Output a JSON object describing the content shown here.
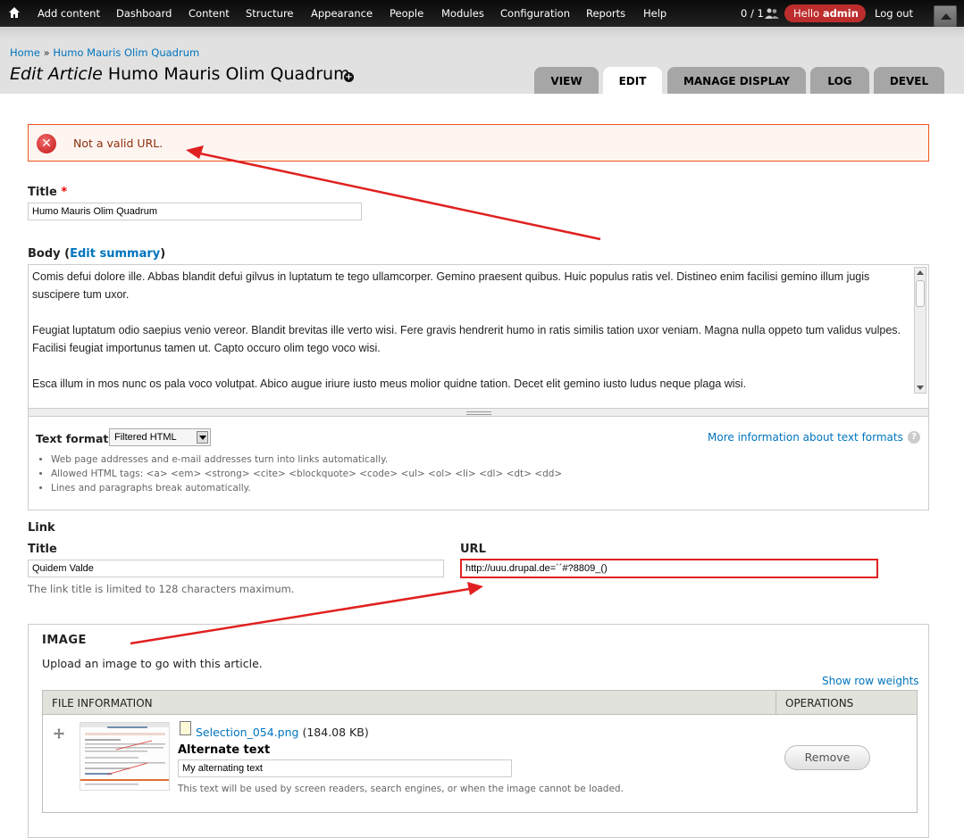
{
  "toolbar": {
    "menu": [
      "Add content",
      "Dashboard",
      "Content",
      "Structure",
      "Appearance",
      "People",
      "Modules",
      "Configuration",
      "Reports",
      "Help"
    ],
    "users_count": "0 / 1",
    "hello_prefix": "Hello",
    "hello_user": "admin",
    "logout": "Log out"
  },
  "breadcrumb": {
    "home": "Home",
    "separator": "»",
    "current": "Humo Mauris Olim Quadrum"
  },
  "page_title": {
    "prefix": "Edit Article",
    "title": "Humo Mauris Olim Quadrum"
  },
  "tabs": [
    "VIEW",
    "EDIT",
    "MANAGE DISPLAY",
    "LOG",
    "DEVEL"
  ],
  "active_tab": "EDIT",
  "message": {
    "type": "error",
    "text": "Not a valid URL."
  },
  "title_field": {
    "label": "Title",
    "required_marker": "*",
    "value": "Humo Mauris Olim Quadrum"
  },
  "body_field": {
    "label": "Body",
    "paren_open": "(",
    "summary_link": "Edit summary",
    "paren_close": ")",
    "paragraphs": [
      "Comis defui dolore ille. Abbas blandit defui gilvus in luptatum te tego ullamcorper. Gemino praesent quibus. Huic populus ratis vel. Distineo enim facilisi gemino illum jugis suscipere tum uxor.",
      "Feugiat luptatum odio saepius venio vereor. Blandit brevitas ille verto wisi. Fere gravis hendrerit humo in ratis similis tation uxor veniam. Magna nulla oppeto tum validus vulpes. Facilisi feugiat importunus tamen ut. Capto occuro olim tego voco wisi.",
      "Esca illum in mos nunc os pala voco volutpat. Abico augue iriure iusto meus molior quidne tation. Decet elit gemino iusto ludus neque plaga wisi."
    ]
  },
  "text_format": {
    "label": "Text format",
    "selected": "Filtered HTML",
    "more_link": "More information about text formats",
    "tips": [
      "Web page addresses and e-mail addresses turn into links automatically.",
      "Allowed HTML tags: <a> <em> <strong> <cite> <blockquote> <code> <ul> <ol> <li> <dl> <dt> <dd>",
      "Lines and paragraphs break automatically."
    ]
  },
  "link_field": {
    "label": "Link",
    "title_label": "Title",
    "title_value": "Quidem Valde",
    "url_label": "URL",
    "url_value": "http://uuu.drupal.de=´´#?8809_()",
    "description": "The link title is limited to 128 characters maximum."
  },
  "image_field": {
    "legend": "IMAGE",
    "description": "Upload an image to go with this article.",
    "row_weights_link": "Show row weights",
    "columns": [
      "FILE INFORMATION",
      "OPERATIONS"
    ],
    "file_name": "Selection_054.png",
    "file_size": "(184.08 KB)",
    "alt_label": "Alternate text",
    "alt_value": "My alternating text",
    "alt_description": "This text will be used by screen readers, search engines, or when the image cannot be loaded.",
    "remove_label": "Remove"
  },
  "colors": {
    "accent_link": "#0074bd",
    "error_border": "#ed541d",
    "annotation_arrow": "#e02020",
    "toolbar_bg": "#111111",
    "hello_badge": "#bd2d2d"
  }
}
